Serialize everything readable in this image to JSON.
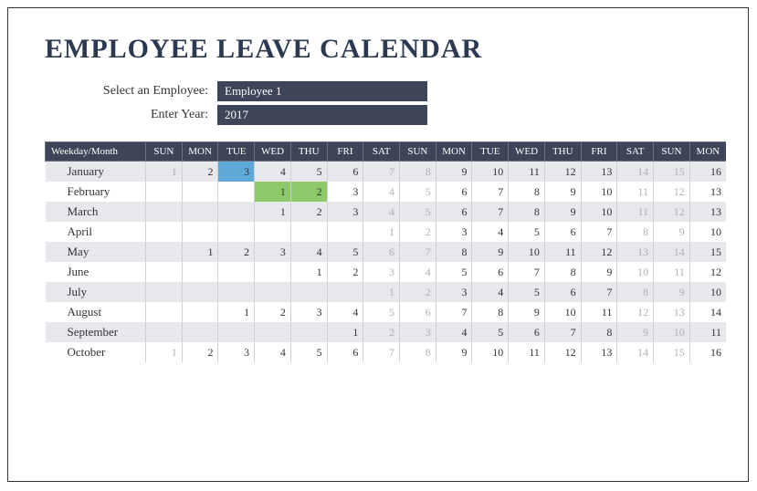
{
  "title": "EMPLOYEE LEAVE CALENDAR",
  "controls": {
    "employee_label": "Select an Employee:",
    "employee_value": "Employee 1",
    "year_label": "Enter Year:",
    "year_value": "2017"
  },
  "header": {
    "month_col": "Weekday/Month",
    "days": [
      "SUN",
      "MON",
      "TUE",
      "WED",
      "THU",
      "FRI",
      "SAT",
      "SUN",
      "MON",
      "TUE",
      "WED",
      "THU",
      "FRI",
      "SAT",
      "SUN",
      "MON"
    ]
  },
  "rows": [
    {
      "month": "January",
      "cells": [
        {
          "v": "1",
          "dim": true
        },
        {
          "v": "2"
        },
        {
          "v": "3",
          "hl": "blue"
        },
        {
          "v": "4"
        },
        {
          "v": "5"
        },
        {
          "v": "6"
        },
        {
          "v": "7",
          "dim": true
        },
        {
          "v": "8",
          "dim": true
        },
        {
          "v": "9"
        },
        {
          "v": "10"
        },
        {
          "v": "11"
        },
        {
          "v": "12"
        },
        {
          "v": "13"
        },
        {
          "v": "14",
          "dim": true
        },
        {
          "v": "15",
          "dim": true
        },
        {
          "v": "16"
        }
      ]
    },
    {
      "month": "February",
      "cells": [
        {
          "v": ""
        },
        {
          "v": ""
        },
        {
          "v": ""
        },
        {
          "v": "1",
          "hl": "green"
        },
        {
          "v": "2",
          "hl": "green"
        },
        {
          "v": "3"
        },
        {
          "v": "4",
          "dim": true
        },
        {
          "v": "5",
          "dim": true
        },
        {
          "v": "6"
        },
        {
          "v": "7"
        },
        {
          "v": "8"
        },
        {
          "v": "9"
        },
        {
          "v": "10"
        },
        {
          "v": "11",
          "dim": true
        },
        {
          "v": "12",
          "dim": true
        },
        {
          "v": "13"
        }
      ]
    },
    {
      "month": "March",
      "cells": [
        {
          "v": ""
        },
        {
          "v": ""
        },
        {
          "v": ""
        },
        {
          "v": "1"
        },
        {
          "v": "2"
        },
        {
          "v": "3"
        },
        {
          "v": "4",
          "dim": true
        },
        {
          "v": "5",
          "dim": true
        },
        {
          "v": "6"
        },
        {
          "v": "7"
        },
        {
          "v": "8"
        },
        {
          "v": "9"
        },
        {
          "v": "10"
        },
        {
          "v": "11",
          "dim": true
        },
        {
          "v": "12",
          "dim": true
        },
        {
          "v": "13"
        }
      ]
    },
    {
      "month": "April",
      "cells": [
        {
          "v": ""
        },
        {
          "v": ""
        },
        {
          "v": ""
        },
        {
          "v": ""
        },
        {
          "v": ""
        },
        {
          "v": ""
        },
        {
          "v": "1",
          "dim": true
        },
        {
          "v": "2",
          "dim": true
        },
        {
          "v": "3"
        },
        {
          "v": "4"
        },
        {
          "v": "5"
        },
        {
          "v": "6"
        },
        {
          "v": "7"
        },
        {
          "v": "8",
          "dim": true
        },
        {
          "v": "9",
          "dim": true
        },
        {
          "v": "10"
        }
      ]
    },
    {
      "month": "May",
      "cells": [
        {
          "v": ""
        },
        {
          "v": "1"
        },
        {
          "v": "2"
        },
        {
          "v": "3"
        },
        {
          "v": "4"
        },
        {
          "v": "5"
        },
        {
          "v": "6",
          "dim": true
        },
        {
          "v": "7",
          "dim": true
        },
        {
          "v": "8"
        },
        {
          "v": "9"
        },
        {
          "v": "10"
        },
        {
          "v": "11"
        },
        {
          "v": "12"
        },
        {
          "v": "13",
          "dim": true
        },
        {
          "v": "14",
          "dim": true
        },
        {
          "v": "15"
        }
      ]
    },
    {
      "month": "June",
      "cells": [
        {
          "v": ""
        },
        {
          "v": ""
        },
        {
          "v": ""
        },
        {
          "v": ""
        },
        {
          "v": "1"
        },
        {
          "v": "2"
        },
        {
          "v": "3",
          "dim": true
        },
        {
          "v": "4",
          "dim": true
        },
        {
          "v": "5"
        },
        {
          "v": "6"
        },
        {
          "v": "7"
        },
        {
          "v": "8"
        },
        {
          "v": "9"
        },
        {
          "v": "10",
          "dim": true
        },
        {
          "v": "11",
          "dim": true
        },
        {
          "v": "12"
        }
      ]
    },
    {
      "month": "July",
      "cells": [
        {
          "v": ""
        },
        {
          "v": ""
        },
        {
          "v": ""
        },
        {
          "v": ""
        },
        {
          "v": ""
        },
        {
          "v": ""
        },
        {
          "v": "1",
          "dim": true
        },
        {
          "v": "2",
          "dim": true
        },
        {
          "v": "3"
        },
        {
          "v": "4"
        },
        {
          "v": "5"
        },
        {
          "v": "6"
        },
        {
          "v": "7"
        },
        {
          "v": "8",
          "dim": true
        },
        {
          "v": "9",
          "dim": true
        },
        {
          "v": "10"
        }
      ]
    },
    {
      "month": "August",
      "cells": [
        {
          "v": ""
        },
        {
          "v": ""
        },
        {
          "v": "1"
        },
        {
          "v": "2"
        },
        {
          "v": "3"
        },
        {
          "v": "4"
        },
        {
          "v": "5",
          "dim": true
        },
        {
          "v": "6",
          "dim": true
        },
        {
          "v": "7"
        },
        {
          "v": "8"
        },
        {
          "v": "9"
        },
        {
          "v": "10"
        },
        {
          "v": "11"
        },
        {
          "v": "12",
          "dim": true
        },
        {
          "v": "13",
          "dim": true
        },
        {
          "v": "14"
        }
      ]
    },
    {
      "month": "September",
      "cells": [
        {
          "v": ""
        },
        {
          "v": ""
        },
        {
          "v": ""
        },
        {
          "v": ""
        },
        {
          "v": ""
        },
        {
          "v": "1"
        },
        {
          "v": "2",
          "dim": true
        },
        {
          "v": "3",
          "dim": true
        },
        {
          "v": "4"
        },
        {
          "v": "5"
        },
        {
          "v": "6"
        },
        {
          "v": "7"
        },
        {
          "v": "8"
        },
        {
          "v": "9",
          "dim": true
        },
        {
          "v": "10",
          "dim": true
        },
        {
          "v": "11"
        }
      ]
    },
    {
      "month": "October",
      "cells": [
        {
          "v": "1",
          "dim": true
        },
        {
          "v": "2"
        },
        {
          "v": "3"
        },
        {
          "v": "4"
        },
        {
          "v": "5"
        },
        {
          "v": "6"
        },
        {
          "v": "7",
          "dim": true
        },
        {
          "v": "8",
          "dim": true
        },
        {
          "v": "9"
        },
        {
          "v": "10"
        },
        {
          "v": "11"
        },
        {
          "v": "12"
        },
        {
          "v": "13"
        },
        {
          "v": "14",
          "dim": true
        },
        {
          "v": "15",
          "dim": true
        },
        {
          "v": "16"
        }
      ]
    }
  ]
}
